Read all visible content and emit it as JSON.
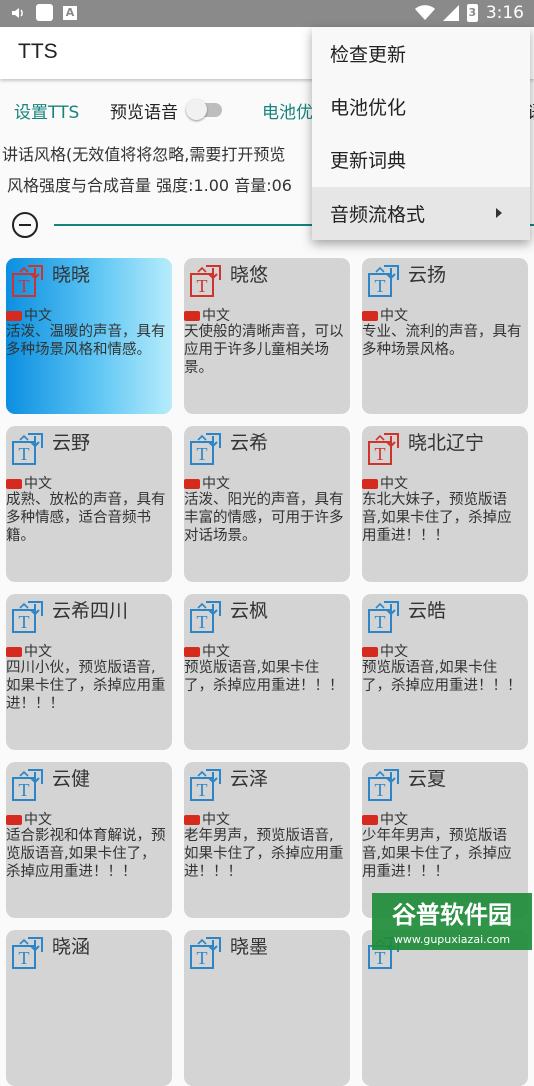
{
  "status_bar": {
    "time": "3:16",
    "battery_glyph": "3"
  },
  "app_bar": {
    "title": "TTS"
  },
  "tabs": {
    "set_tts": "设置TTS",
    "preview_voice": "预览语音",
    "battery": "电池优",
    "cut": "语"
  },
  "preview_switch_on": false,
  "style_line": "讲话风格(无效值将将忽略,需要打开预览",
  "strength_line": "风格强度与合成音量   强度:1.00 音量:06",
  "accent_color": "#16847c",
  "menu": {
    "items": [
      {
        "label": "检查更新"
      },
      {
        "label": "电池优化"
      },
      {
        "label": "更新词典"
      },
      {
        "label": "音频流格式"
      }
    ]
  },
  "voices": [
    {
      "name": "晓晓",
      "lang": "中文",
      "desc": "活泼、温暖的声音，具有多种场景风格和情感。"
    },
    {
      "name": "晓悠",
      "lang": "中文",
      "desc": "天使般的清晰声音，可以应用于许多儿童相关场景。"
    },
    {
      "name": "云扬",
      "lang": "中文",
      "desc": "专业、流利的声音，具有多种场景风格。"
    },
    {
      "name": "云野",
      "lang": "中文",
      "desc": "成熟、放松的声音，具有多种情感，适合音频书籍。"
    },
    {
      "name": "云希",
      "lang": "中文",
      "desc": "活泼、阳光的声音，具有丰富的情感，可用于许多对话场景。"
    },
    {
      "name": "晓北辽宁",
      "lang": "中文",
      "desc": "东北大妹子，预览版语音,如果卡住了，杀掉应用重进！！！"
    },
    {
      "name": "云希四川",
      "lang": "中文",
      "desc": "四川小伙，预览版语音,如果卡住了，杀掉应用重进！！！"
    },
    {
      "name": "云枫",
      "lang": "中文",
      "desc": "预览版语音,如果卡住了，杀掉应用重进！！！"
    },
    {
      "name": "云皓",
      "lang": "中文",
      "desc": "预览版语音,如果卡住了，杀掉应用重进！！！"
    },
    {
      "name": "云健",
      "lang": "中文",
      "desc": "适合影视和体育解说，预览版语音,如果卡住了，杀掉应用重进！！！"
    },
    {
      "name": "云泽",
      "lang": "中文",
      "desc": "老年男声，预览版语音,如果卡住了，杀掉应用重进！！！"
    },
    {
      "name": "云夏",
      "lang": "中文",
      "desc": "少年年男声，预览版语音,如果卡住了，杀掉应用重进！！！"
    },
    {
      "name": "晓涵",
      "lang": "",
      "desc": ""
    },
    {
      "name": "晓墨",
      "lang": "",
      "desc": ""
    },
    {
      "name": "",
      "lang": "",
      "desc": ""
    }
  ],
  "watermark": {
    "brand": "谷普软件园",
    "url": "www.gupuxiazai.com"
  }
}
